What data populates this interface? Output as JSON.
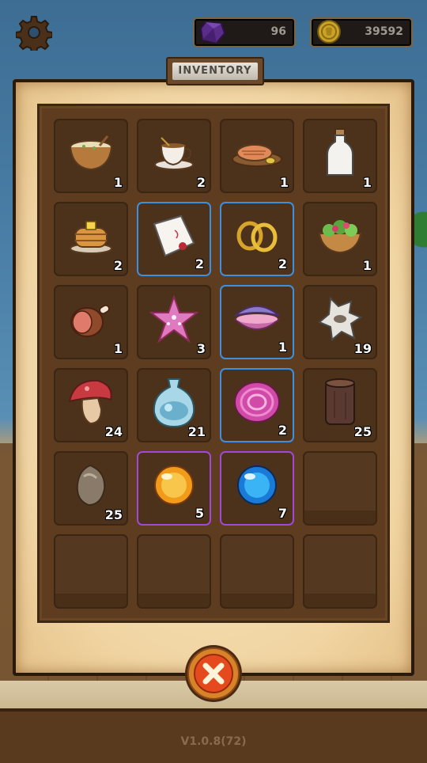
{
  "hud": {
    "gem_count": "96",
    "coin_count": "39592"
  },
  "title": "INVENTORY",
  "version": "V1.0.8(72)",
  "slots": [
    {
      "icon": "soup-bowl-icon",
      "count": "1",
      "border": "none"
    },
    {
      "icon": "tea-cup-icon",
      "count": "2",
      "border": "none"
    },
    {
      "icon": "grilled-fish-icon",
      "count": "1",
      "border": "none"
    },
    {
      "icon": "milk-bottle-icon",
      "count": "1",
      "border": "none"
    },
    {
      "icon": "pancakes-icon",
      "count": "2",
      "border": "none"
    },
    {
      "icon": "handkerchief-icon",
      "count": "2",
      "border": "blue"
    },
    {
      "icon": "gold-earrings-icon",
      "count": "2",
      "border": "blue"
    },
    {
      "icon": "salad-bowl-icon",
      "count": "1",
      "border": "none"
    },
    {
      "icon": "ham-leg-icon",
      "count": "1",
      "border": "none"
    },
    {
      "icon": "pink-starfish-icon",
      "count": "3",
      "border": "none"
    },
    {
      "icon": "pink-clam-icon",
      "count": "1",
      "border": "blue"
    },
    {
      "icon": "animal-hide-icon",
      "count": "19",
      "border": "none"
    },
    {
      "icon": "red-mushroom-icon",
      "count": "24",
      "border": "none"
    },
    {
      "icon": "water-pouch-icon",
      "count": "21",
      "border": "none"
    },
    {
      "icon": "pink-shell-icon",
      "count": "2",
      "border": "blue"
    },
    {
      "icon": "wood-log-icon",
      "count": "25",
      "border": "none"
    },
    {
      "icon": "stone-icon",
      "count": "25",
      "border": "none"
    },
    {
      "icon": "orange-orb-icon",
      "count": "5",
      "border": "purple"
    },
    {
      "icon": "blue-orb-icon",
      "count": "7",
      "border": "purple"
    }
  ],
  "empty_slot_count": 5,
  "colors": {
    "rare_border": "#3d8fe0",
    "epic_border": "#a347d6",
    "panel_brown": "#5d3c1f",
    "parchment": "#f1d6a4"
  }
}
